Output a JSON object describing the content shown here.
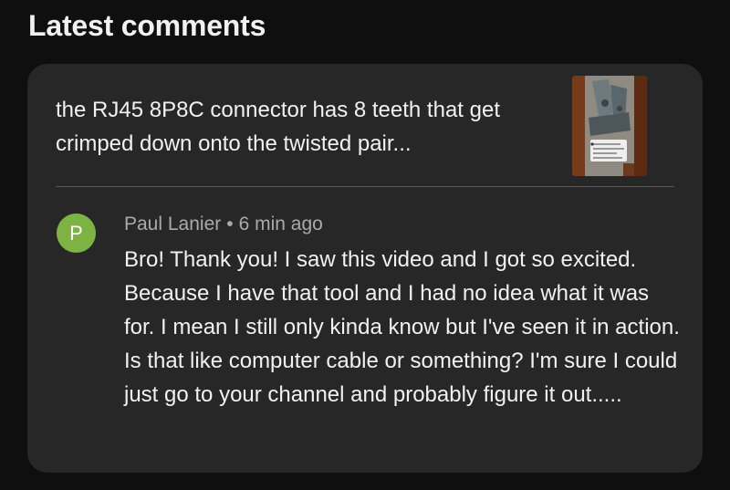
{
  "section": {
    "title": "Latest comments"
  },
  "video": {
    "title": "the RJ45 8P8C connector has 8 teeth that get crimped down onto the twisted pair...",
    "thumbnail_icon": "crimp-tool-video-thumbnail"
  },
  "comment": {
    "avatar_letter": "P",
    "avatar_color": "#7cb342",
    "author": "Paul Lanier",
    "separator": "•",
    "time": "6 min ago",
    "text": "Bro! Thank you! I saw this video and I got so excited. Because I have that tool and I had no idea what it was for. I mean I still only kinda know but I've seen it in action. Is that like computer cable or something? I'm sure I could just go to your channel and probably figure it out....."
  },
  "colors": {
    "background": "#0f0f0f",
    "card": "#272727",
    "primary_text": "#f1f1f1",
    "secondary_text": "#aaaaaa"
  }
}
